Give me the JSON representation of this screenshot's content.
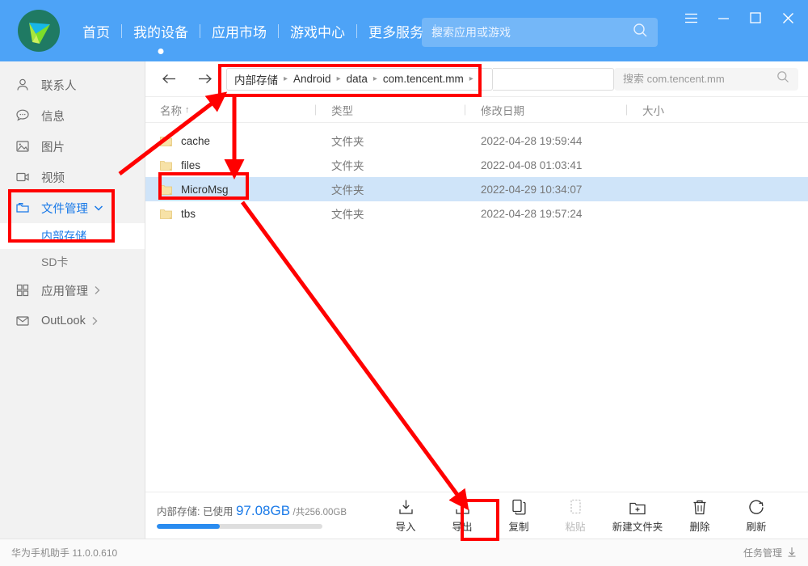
{
  "header": {
    "logo_icon": "huawei-hisuite-logo",
    "nav": [
      {
        "label": "首页",
        "active": false
      },
      {
        "label": "我的设备",
        "active": true
      },
      {
        "label": "应用市场",
        "active": false
      },
      {
        "label": "游戏中心",
        "active": false
      },
      {
        "label": "更多服务",
        "active": false
      }
    ],
    "search": {
      "placeholder": "搜索应用或游戏",
      "value": "",
      "icon": "search-icon"
    },
    "window_controls": [
      {
        "name": "menu-icon",
        "glyph": "hamburger"
      },
      {
        "name": "minimize-icon",
        "glyph": "minimize"
      },
      {
        "name": "maximize-icon",
        "glyph": "maximize"
      },
      {
        "name": "close-icon",
        "glyph": "close"
      }
    ]
  },
  "sidebar": {
    "items": [
      {
        "label": "联系人",
        "icon": "contacts-person-icon",
        "active": false,
        "chevron": ""
      },
      {
        "label": "信息",
        "icon": "message-bubble-icon",
        "active": false,
        "chevron": ""
      },
      {
        "label": "图片",
        "icon": "picture-icon",
        "active": false,
        "chevron": ""
      },
      {
        "label": "视频",
        "icon": "video-camera-icon",
        "active": false,
        "chevron": ""
      },
      {
        "label": "文件管理",
        "icon": "folder-icon",
        "active": true,
        "chevron": "down"
      }
    ],
    "sub_items": [
      {
        "label": "内部存储",
        "selected": true
      },
      {
        "label": "SD卡",
        "selected": false
      }
    ],
    "items_after": [
      {
        "label": "应用管理",
        "icon": "apps-grid-icon",
        "active": false,
        "chevron": "right"
      },
      {
        "label": "OutLook",
        "icon": "mail-envelope-icon",
        "active": false,
        "chevron": "right"
      }
    ]
  },
  "main": {
    "nav_back_icon": "arrow-left-icon",
    "nav_forward_icon": "arrow-right-icon",
    "breadcrumb": [
      "内部存储",
      "Android",
      "data",
      "com.tencent.mm"
    ],
    "file_search": {
      "placeholder": "搜索 com.tencent.mm",
      "value": "",
      "icon": "search-icon"
    },
    "columns": [
      {
        "label": "名称",
        "sort": "↑"
      },
      {
        "label": "类型",
        "sort": ""
      },
      {
        "label": "修改日期",
        "sort": ""
      },
      {
        "label": "大小",
        "sort": ""
      }
    ],
    "rows": [
      {
        "name": "cache",
        "type": "文件夹",
        "date": "2022-04-28 19:59:44",
        "size": "",
        "selected": false
      },
      {
        "name": "files",
        "type": "文件夹",
        "date": "2022-04-08 01:03:41",
        "size": "",
        "selected": false
      },
      {
        "name": "MicroMsg",
        "type": "文件夹",
        "date": "2022-04-29 10:34:07",
        "size": "",
        "selected": true
      },
      {
        "name": "tbs",
        "type": "文件夹",
        "date": "2022-04-28 19:57:24",
        "size": "",
        "selected": false
      }
    ]
  },
  "toolbar": {
    "storage_prefix": "内部存储: 已使用",
    "storage_used": "97.08GB",
    "storage_total": "/共256.00GB",
    "storage_percent": 38,
    "buttons": [
      {
        "label": "导入",
        "icon": "import-download-icon",
        "disabled": false,
        "highlighted": false
      },
      {
        "label": "导出",
        "icon": "export-upload-icon",
        "disabled": false,
        "highlighted": true
      },
      {
        "label": "复制",
        "icon": "copy-icon",
        "disabled": false,
        "highlighted": false
      },
      {
        "label": "粘贴",
        "icon": "paste-icon",
        "disabled": true,
        "highlighted": false
      },
      {
        "label": "新建文件夹",
        "icon": "new-folder-icon",
        "disabled": false,
        "highlighted": false
      },
      {
        "label": "删除",
        "icon": "trash-delete-icon",
        "disabled": false,
        "highlighted": false
      },
      {
        "label": "刷新",
        "icon": "refresh-icon",
        "disabled": false,
        "highlighted": false
      }
    ]
  },
  "statusbar": {
    "app_name": "华为手机助手",
    "version": "11.0.0.610",
    "task_label": "任务管理",
    "task_icon": "download-arrow-icon"
  },
  "annotations": {
    "color": "#ff0000",
    "boxes": [
      "sidebar-internal-storage",
      "breadcrumb-path",
      "micromsg-row",
      "export-button"
    ],
    "arrows": [
      "sidebar-to-breadcrumb",
      "breadcrumb-to-micromsg",
      "micromsg-to-export"
    ]
  },
  "colors": {
    "brand_blue": "#4da3f7",
    "accent_blue": "#1a7ae8",
    "selection_blue": "#cfe4f9",
    "annotation_red": "#ff0000",
    "folder_yellow": "#f6dfa0"
  }
}
